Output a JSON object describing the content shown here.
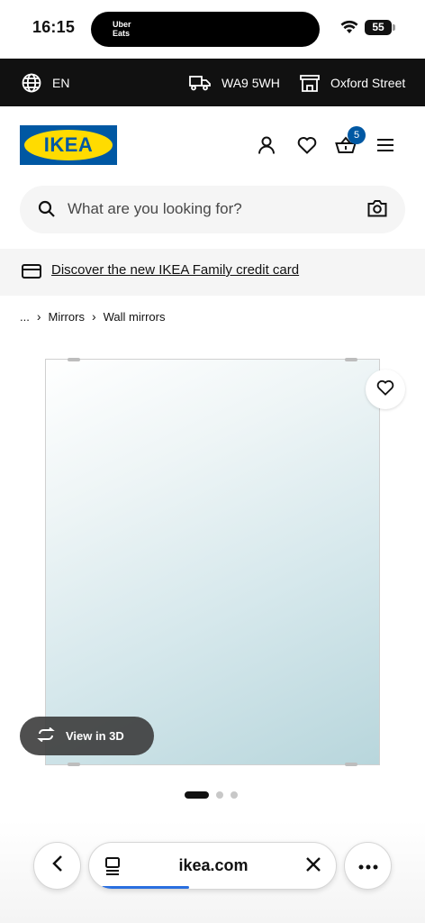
{
  "status_bar": {
    "time": "16:15",
    "island_app": "Uber Eats",
    "battery": "55"
  },
  "topbar": {
    "language": "EN",
    "postcode": "WA9 5WH",
    "store": "Oxford Street"
  },
  "header": {
    "logo_text": "IKEA",
    "cart_count": "5",
    "icons": [
      "user-icon",
      "heart-icon",
      "basket-icon",
      "menu-icon"
    ]
  },
  "search": {
    "placeholder": "What are you looking for?"
  },
  "promo": {
    "text": "Discover the new IKEA Family credit card"
  },
  "breadcrumb": {
    "ellipsis": "...",
    "items": [
      "Mirrors",
      "Wall mirrors"
    ]
  },
  "product": {
    "view_3d_label": "View in 3D",
    "carousel_count": 3,
    "carousel_active": 1
  },
  "browser": {
    "url": "ikea.com",
    "load_progress": 0.35
  },
  "colors": {
    "ikea_blue": "#0058a3",
    "ikea_yellow": "#ffdb00",
    "topbar_bg": "#111111",
    "progress_blue": "#2a6fe0"
  }
}
